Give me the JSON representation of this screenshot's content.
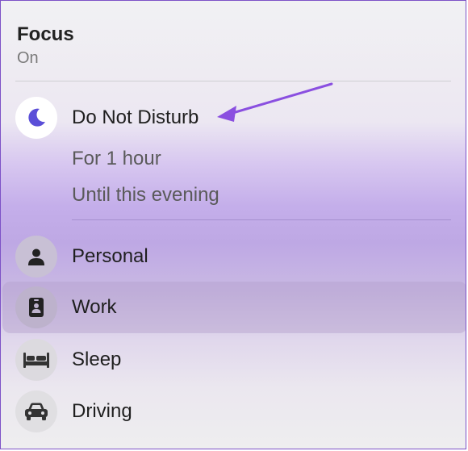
{
  "header": {
    "title": "Focus",
    "status": "On"
  },
  "dnd": {
    "label": "Do Not Disturb",
    "options": [
      "For 1 hour",
      "Until this evening"
    ]
  },
  "modes": [
    {
      "label": "Personal",
      "icon": "person-icon"
    },
    {
      "label": "Work",
      "icon": "badge-icon",
      "selected": true
    },
    {
      "label": "Sleep",
      "icon": "bed-icon"
    },
    {
      "label": "Driving",
      "icon": "car-icon"
    }
  ],
  "colors": {
    "accent": "#7d52c7",
    "moon": "#5b4fd8"
  }
}
